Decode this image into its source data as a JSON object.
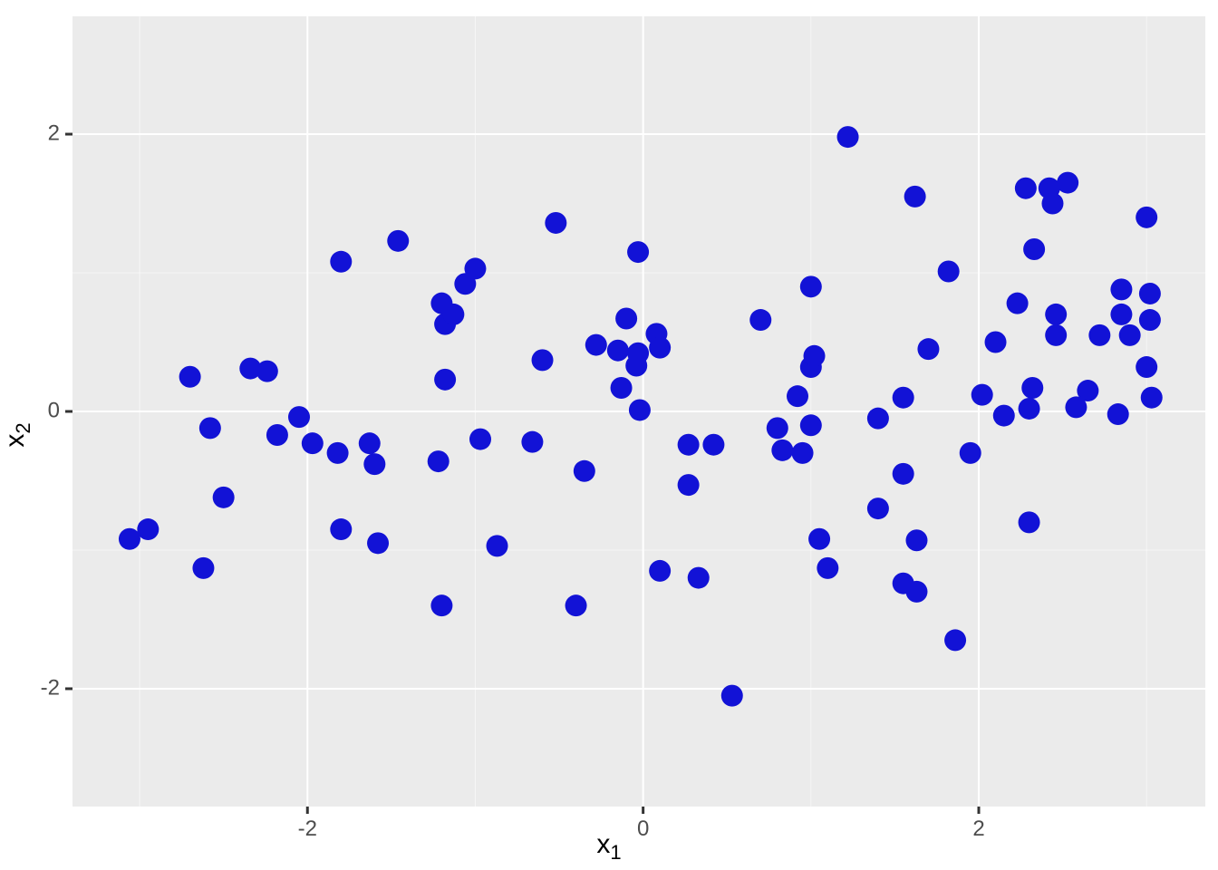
{
  "chart_data": {
    "type": "scatter",
    "title": "",
    "xlabel": "x1",
    "ylabel": "x2",
    "xlim": [
      -3.4,
      3.35
    ],
    "ylim": [
      -2.85,
      2.85
    ],
    "x_ticks": [
      -2,
      0,
      2
    ],
    "y_ticks": [
      -2,
      0,
      2
    ],
    "point_color": "#1212d6",
    "point_radius_px": 12,
    "points": [
      [
        -3.06,
        -0.92
      ],
      [
        -2.95,
        -0.85
      ],
      [
        -2.7,
        0.25
      ],
      [
        -2.62,
        -1.13
      ],
      [
        -2.58,
        -0.12
      ],
      [
        -2.5,
        -0.62
      ],
      [
        -2.34,
        0.31
      ],
      [
        -2.24,
        0.29
      ],
      [
        -2.18,
        -0.17
      ],
      [
        -2.05,
        -0.04
      ],
      [
        -1.97,
        -0.23
      ],
      [
        -1.82,
        -0.3
      ],
      [
        -1.8,
        -0.85
      ],
      [
        -1.8,
        1.08
      ],
      [
        -1.6,
        -0.38
      ],
      [
        -1.63,
        -0.23
      ],
      [
        -1.58,
        -0.95
      ],
      [
        -1.46,
        1.23
      ],
      [
        -1.2,
        -1.4
      ],
      [
        -1.22,
        -0.36
      ],
      [
        -1.2,
        0.78
      ],
      [
        -1.18,
        0.63
      ],
      [
        -1.18,
        0.23
      ],
      [
        -1.13,
        0.7
      ],
      [
        -1.06,
        0.92
      ],
      [
        -1.0,
        1.03
      ],
      [
        -0.97,
        -0.2
      ],
      [
        -0.87,
        -0.97
      ],
      [
        -0.66,
        -0.22
      ],
      [
        -0.6,
        0.37
      ],
      [
        -0.52,
        1.36
      ],
      [
        -0.4,
        -1.4
      ],
      [
        -0.35,
        -0.43
      ],
      [
        -0.28,
        0.48
      ],
      [
        -0.15,
        0.44
      ],
      [
        -0.13,
        0.17
      ],
      [
        -0.1,
        0.67
      ],
      [
        -0.03,
        1.15
      ],
      [
        -0.03,
        0.42
      ],
      [
        -0.04,
        0.33
      ],
      [
        -0.02,
        0.01
      ],
      [
        0.08,
        0.56
      ],
      [
        0.1,
        0.46
      ],
      [
        0.1,
        -1.15
      ],
      [
        0.27,
        -0.53
      ],
      [
        0.27,
        -0.24
      ],
      [
        0.33,
        -1.2
      ],
      [
        0.42,
        -0.24
      ],
      [
        0.53,
        -2.05
      ],
      [
        0.7,
        0.66
      ],
      [
        0.8,
        -0.12
      ],
      [
        0.83,
        -0.28
      ],
      [
        0.92,
        0.11
      ],
      [
        0.95,
        -0.3
      ],
      [
        1.0,
        0.9
      ],
      [
        1.0,
        0.32
      ],
      [
        1.0,
        -0.1
      ],
      [
        1.02,
        0.4
      ],
      [
        1.05,
        -0.92
      ],
      [
        1.1,
        -1.13
      ],
      [
        1.22,
        1.98
      ],
      [
        1.4,
        -0.05
      ],
      [
        1.4,
        -0.7
      ],
      [
        1.55,
        0.1
      ],
      [
        1.55,
        -0.45
      ],
      [
        1.55,
        -1.24
      ],
      [
        1.62,
        1.55
      ],
      [
        1.63,
        -0.93
      ],
      [
        1.63,
        -1.3
      ],
      [
        1.7,
        0.45
      ],
      [
        1.82,
        1.01
      ],
      [
        1.86,
        -1.65
      ],
      [
        1.95,
        -0.3
      ],
      [
        2.02,
        0.12
      ],
      [
        2.1,
        0.5
      ],
      [
        2.15,
        -0.03
      ],
      [
        2.23,
        0.78
      ],
      [
        2.28,
        1.61
      ],
      [
        2.3,
        0.02
      ],
      [
        2.32,
        0.17
      ],
      [
        2.3,
        -0.8
      ],
      [
        2.33,
        1.17
      ],
      [
        2.42,
        1.61
      ],
      [
        2.44,
        1.5
      ],
      [
        2.46,
        0.7
      ],
      [
        2.46,
        0.55
      ],
      [
        2.53,
        1.65
      ],
      [
        2.58,
        0.03
      ],
      [
        2.65,
        0.15
      ],
      [
        2.72,
        0.55
      ],
      [
        2.85,
        0.88
      ],
      [
        2.85,
        0.7
      ],
      [
        2.83,
        -0.02
      ],
      [
        2.9,
        0.55
      ],
      [
        3.0,
        1.4
      ],
      [
        3.02,
        0.85
      ],
      [
        3.02,
        0.66
      ],
      [
        3.0,
        0.32
      ],
      [
        3.03,
        0.1
      ]
    ]
  }
}
